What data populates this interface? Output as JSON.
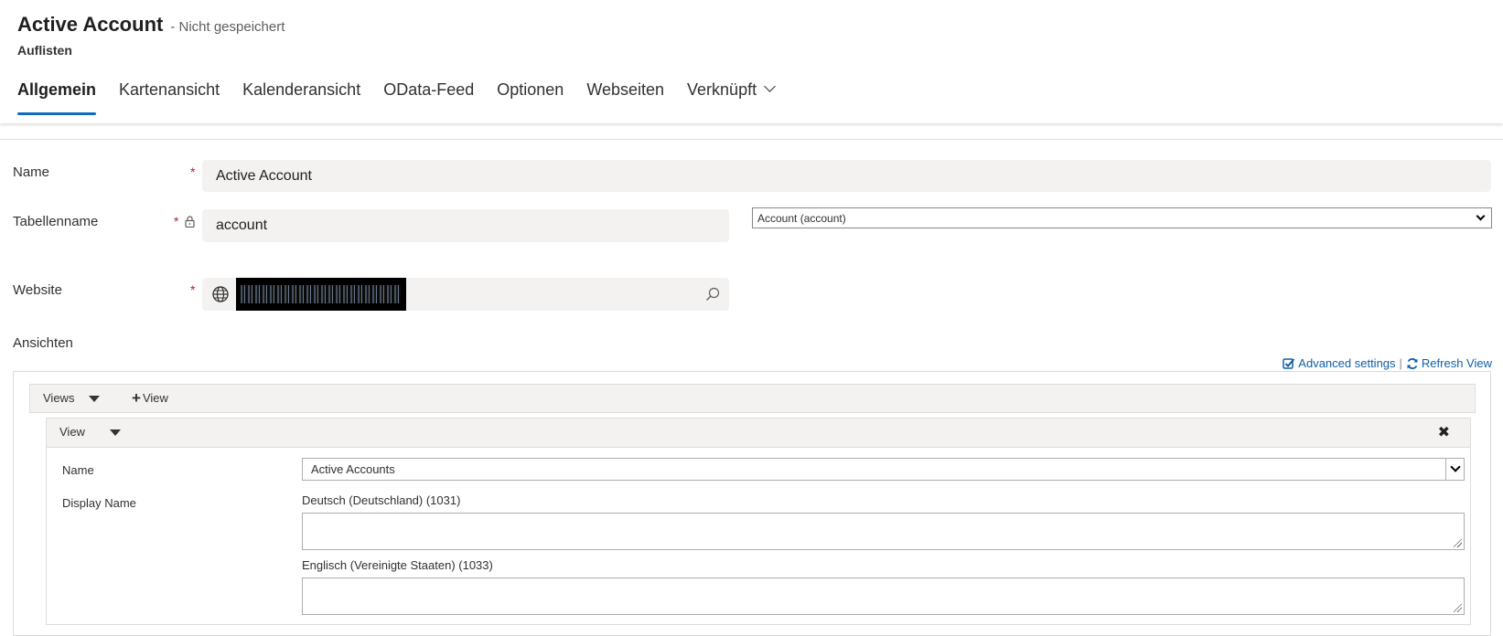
{
  "header": {
    "title": "Active Account",
    "status": "- Nicht gespeichert",
    "subtitle": "Auflisten"
  },
  "tabs": [
    {
      "label": "Allgemein",
      "active": true
    },
    {
      "label": "Kartenansicht"
    },
    {
      "label": "Kalenderansicht"
    },
    {
      "label": "OData-Feed"
    },
    {
      "label": "Optionen"
    },
    {
      "label": "Webseiten"
    },
    {
      "label": "Verknüpft",
      "has_dropdown": true
    }
  ],
  "form": {
    "name": {
      "label": "Name",
      "required_mark": "*",
      "value": "Active Account"
    },
    "table": {
      "label": "Tabellenname",
      "required_mark": "*",
      "value": "account",
      "select_value": "Account (account)"
    },
    "website": {
      "label": "Website",
      "required_mark": "*",
      "value_redacted": true
    },
    "views_section_label": "Ansichten"
  },
  "links": {
    "advanced": "Advanced settings",
    "separator": "|",
    "refresh": "Refresh View"
  },
  "views": {
    "bar_label": "Views",
    "add_label": "View",
    "panel": {
      "title": "View",
      "close_symbol": "✖",
      "name_label": "Name",
      "name_value": "Active Accounts",
      "display_name_label": "Display Name",
      "lang1_label": "Deutsch (Deutschland) (1031)",
      "lang1_value": "",
      "lang2_label": "Englisch (Vereinigte Staaten) (1033)",
      "lang2_value": ""
    }
  },
  "colors": {
    "accent": "#0f6cbd",
    "required": "#a4262c",
    "link": "#0f5fa8",
    "field_bg": "#f3f2f1"
  }
}
